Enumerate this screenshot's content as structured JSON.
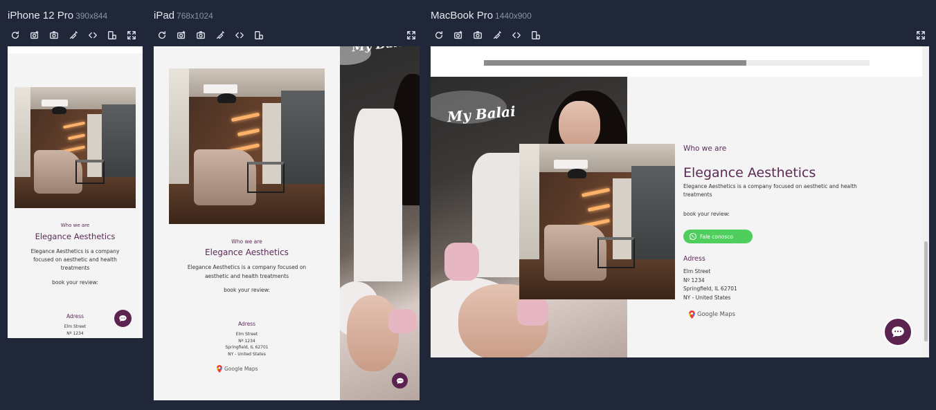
{
  "devices": [
    {
      "name": "iPhone 12 Pro",
      "dims": "390x844"
    },
    {
      "name": "iPad",
      "dims": "768x1024"
    },
    {
      "name": "MacBook Pro",
      "dims": "1440x900"
    }
  ],
  "site": {
    "logo": "My Balai",
    "eyebrow": "Who we are",
    "title": "Elegance Aesthetics",
    "description": "Elegance Aesthetics is a company focused on aesthetic and health treatments",
    "review_prompt": "book your review:",
    "whatsapp_label": "Fale conosco",
    "address_heading": "Adress",
    "address_lines": [
      "Elm Street",
      "Nº 1234",
      "Springfield, IL 62701",
      "NY - United States"
    ],
    "maps_label": "Google Maps"
  },
  "colors": {
    "page_bg": "#1f2738",
    "accent_purple": "#5a2a55",
    "whatsapp_green": "#4fce5d",
    "chat_bubble": "#5b2350"
  },
  "loading_progress": 0.68
}
